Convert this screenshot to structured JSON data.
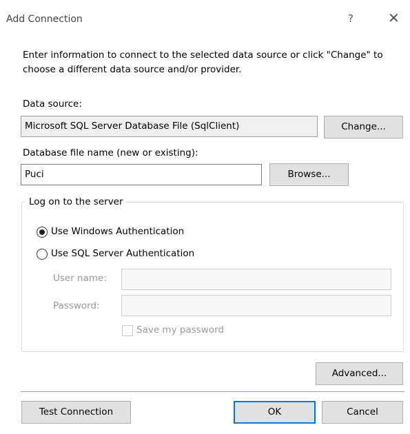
{
  "window": {
    "title": "Add Connection",
    "help_glyph": "?",
    "close_glyph": "✕"
  },
  "description": "Enter information to connect to the selected data source or click \"Change\" to choose a different data source and/or provider.",
  "data_source": {
    "label": "Data source:",
    "value": "Microsoft SQL Server Database File (SqlClient)",
    "change_label": "Change..."
  },
  "database_file": {
    "label": "Database file name (new or existing):",
    "value": "Puci",
    "browse_label": "Browse..."
  },
  "logon": {
    "group_label": "Log on to the server",
    "windows_auth_label": "Use Windows Authentication",
    "sql_auth_label": "Use SQL Server Authentication",
    "selected": "windows",
    "user_name_label": "User name:",
    "user_name_value": "",
    "password_label": "Password:",
    "password_value": "",
    "save_password_label": "Save my password",
    "save_password_checked": false
  },
  "buttons": {
    "advanced": "Advanced...",
    "test_connection": "Test Connection",
    "ok": "OK",
    "cancel": "Cancel"
  },
  "colors": {
    "accent": "#0078d7",
    "button_bg": "#e1e1e1",
    "disabled_text": "#9a9a9a"
  }
}
